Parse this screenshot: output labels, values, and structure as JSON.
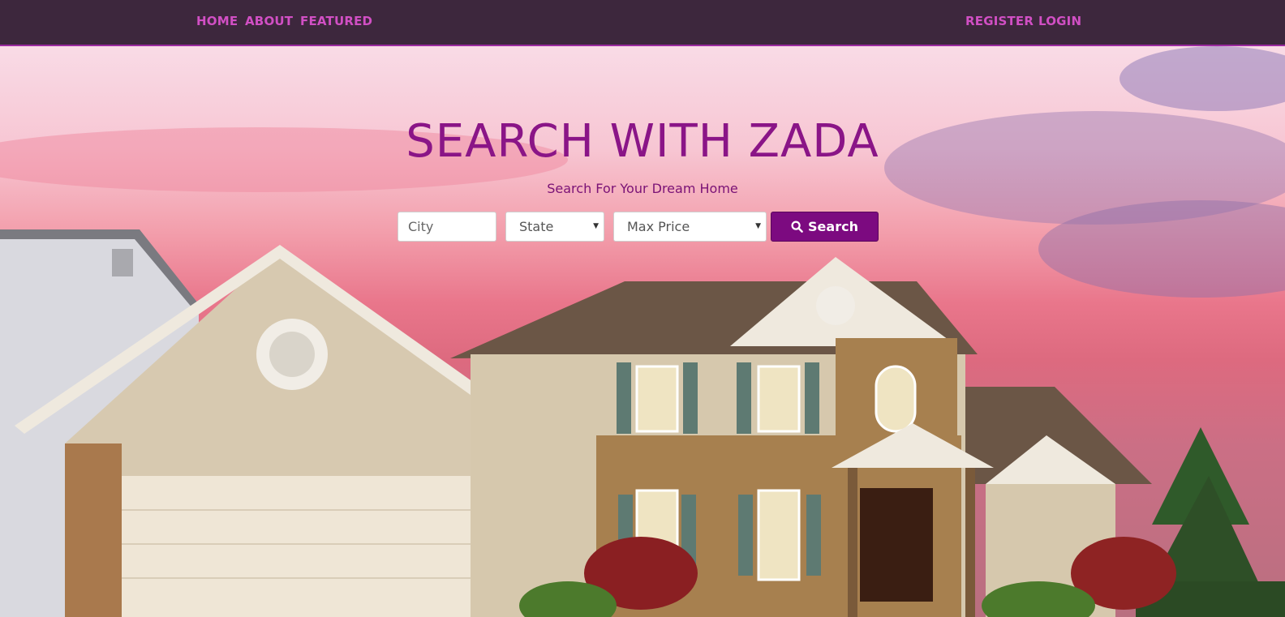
{
  "nav": {
    "home": "HOME",
    "about": "ABOUT",
    "featured": "FEATURED",
    "register": "REGISTER",
    "login": "LOGIN"
  },
  "hero": {
    "title": "SEARCH WITH ZADA",
    "subtitle": "Search For Your Dream Home"
  },
  "search": {
    "city_placeholder": "City",
    "state_selected": "State",
    "price_selected": "Max Price",
    "button_label": "Search",
    "button_icon": "search-icon"
  },
  "colors": {
    "navbar_bg": "#3d273d",
    "nav_link": "#d14fc4",
    "accent": "#7c0a80",
    "title": "#8a1587"
  }
}
